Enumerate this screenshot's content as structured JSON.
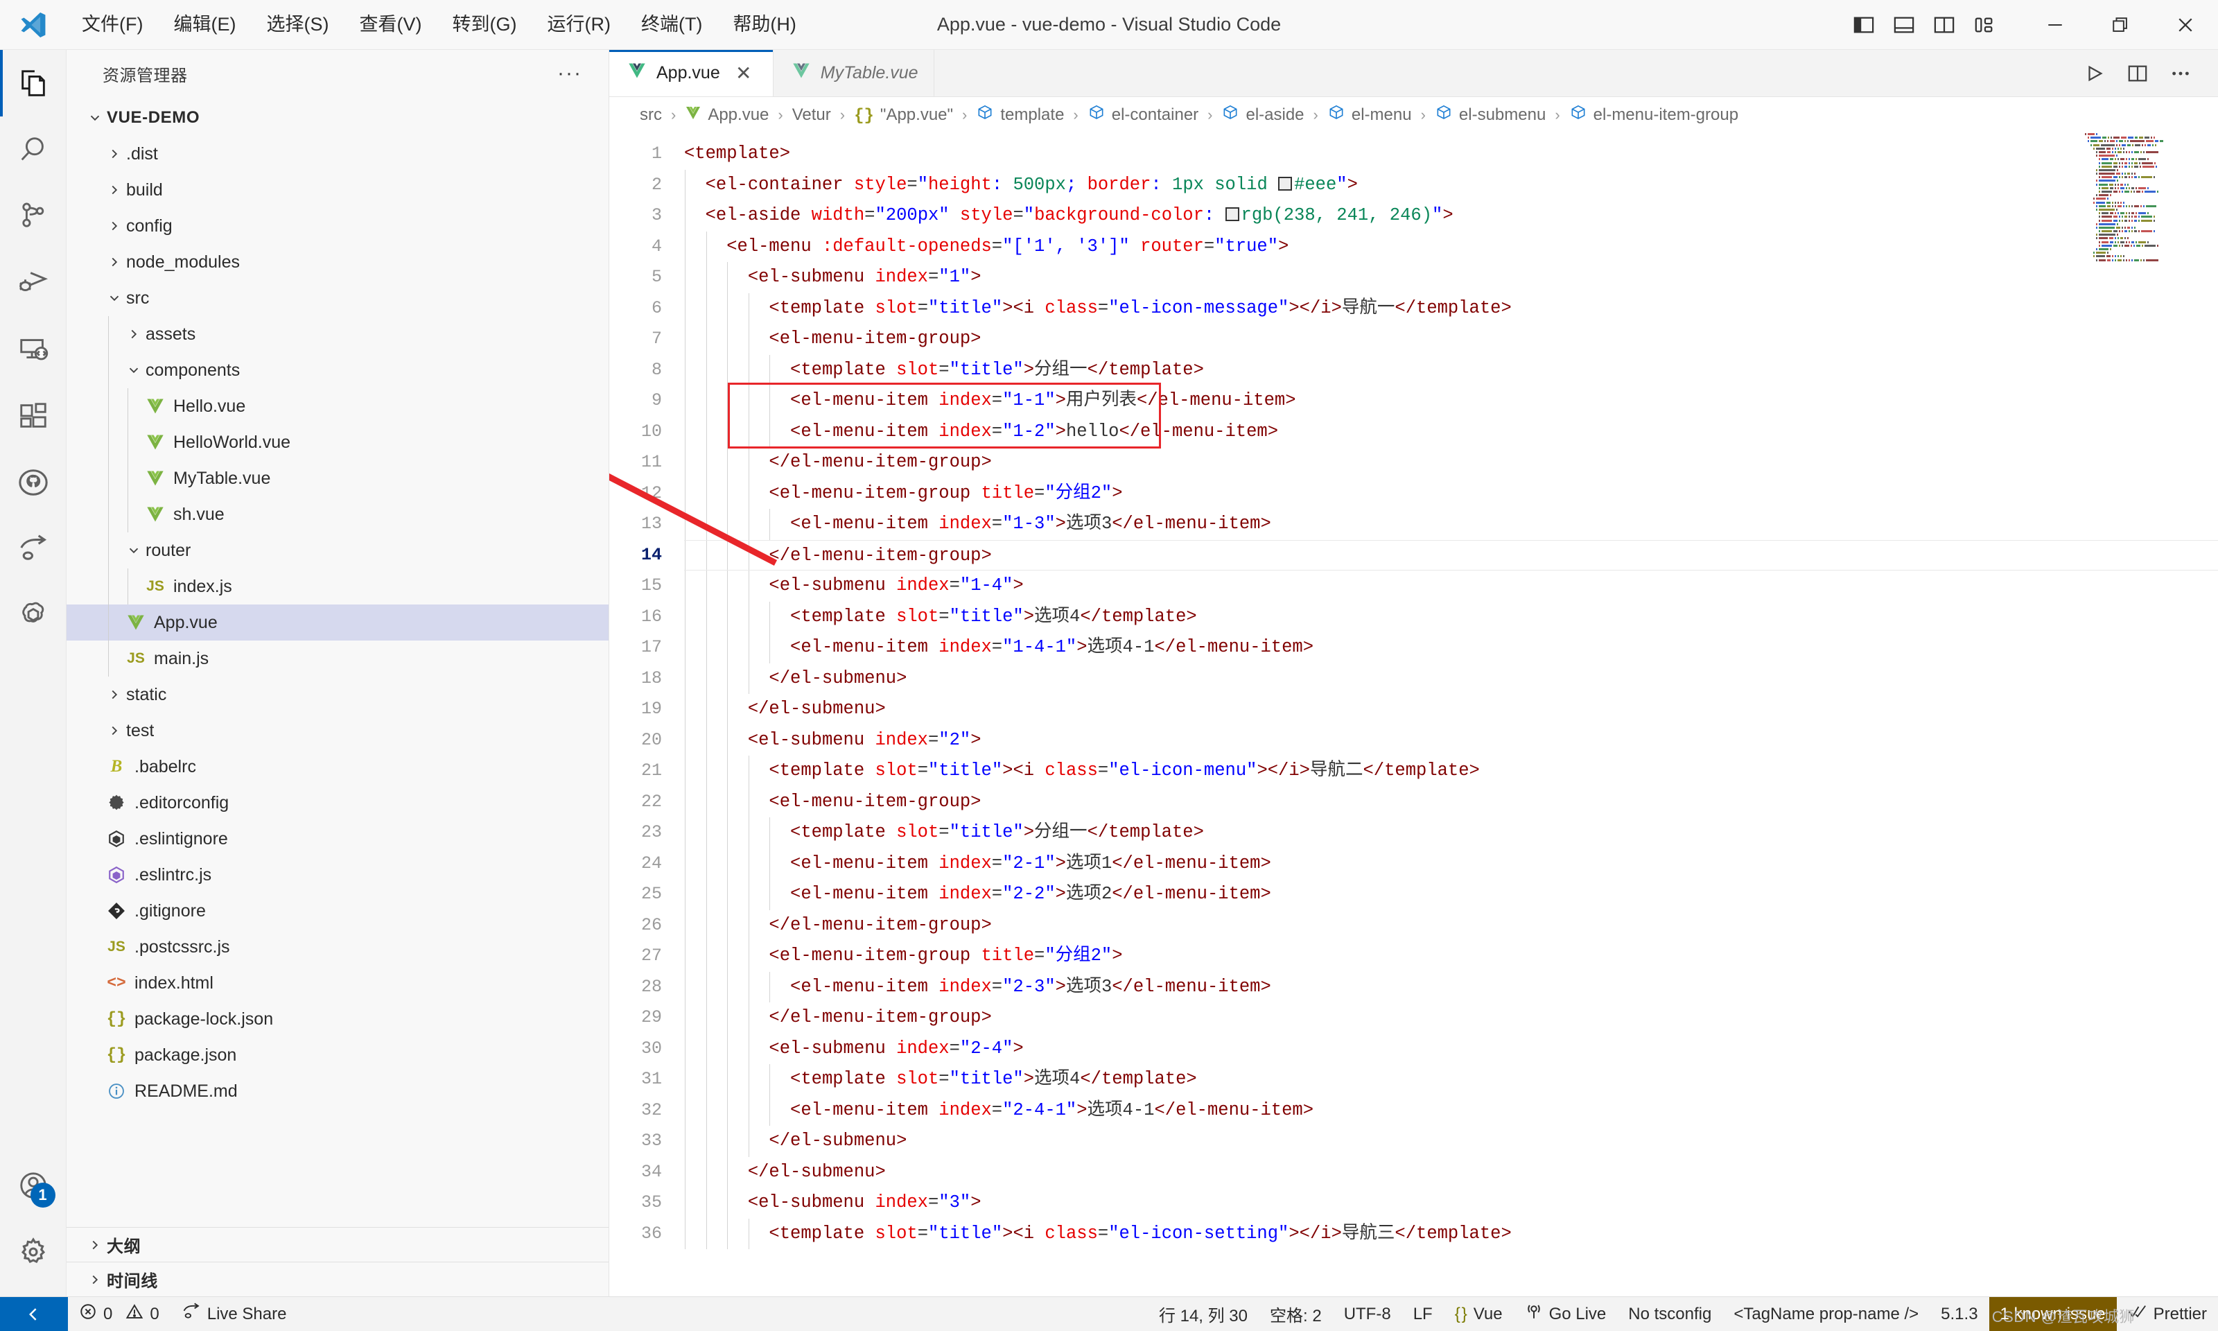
{
  "window": {
    "title": "App.vue - vue-demo - Visual Studio Code",
    "menus": [
      {
        "label": "文件(F)",
        "name": "menu-file"
      },
      {
        "label": "编辑(E)",
        "name": "menu-edit"
      },
      {
        "label": "选择(S)",
        "name": "menu-selection"
      },
      {
        "label": "查看(V)",
        "name": "menu-view"
      },
      {
        "label": "转到(G)",
        "name": "menu-goto"
      },
      {
        "label": "运行(R)",
        "name": "menu-run"
      },
      {
        "label": "终端(T)",
        "name": "menu-terminal"
      },
      {
        "label": "帮助(H)",
        "name": "menu-help"
      }
    ],
    "layout_buttons": [
      "toggle-primary-sidebar",
      "toggle-panel",
      "toggle-secondary-sidebar",
      "customize-layout"
    ],
    "controls": {
      "minimize": "—",
      "maximize": "❐",
      "close": "✕"
    }
  },
  "activitybar": {
    "items": [
      {
        "name": "explorer",
        "icon": "files-icon",
        "active": true
      },
      {
        "name": "search",
        "icon": "search-icon",
        "active": false
      },
      {
        "name": "source-control",
        "icon": "source-control-icon",
        "active": false
      },
      {
        "name": "run-and-debug",
        "icon": "debug-icon",
        "active": false
      },
      {
        "name": "remote-explorer",
        "icon": "remote-icon",
        "active": false
      },
      {
        "name": "extensions",
        "icon": "extensions-icon",
        "active": false
      },
      {
        "name": "github",
        "icon": "github-icon",
        "active": false
      },
      {
        "name": "live-share",
        "icon": "live-share-icon",
        "active": false
      },
      {
        "name": "openai",
        "icon": "openai-icon",
        "active": false
      }
    ],
    "bottom": [
      {
        "name": "accounts",
        "icon": "account-icon",
        "badge": "1"
      },
      {
        "name": "settings",
        "icon": "gear-icon",
        "badge": ""
      }
    ]
  },
  "sidebar": {
    "header": "资源管理器",
    "more_actions": "···",
    "root": {
      "label": "VUE-DEMO",
      "expanded": true
    },
    "tree": [
      {
        "label": ".dist",
        "depth": 1,
        "type": "folder",
        "expanded": false
      },
      {
        "label": "build",
        "depth": 1,
        "type": "folder",
        "expanded": false
      },
      {
        "label": "config",
        "depth": 1,
        "type": "folder",
        "expanded": false
      },
      {
        "label": "node_modules",
        "depth": 1,
        "type": "folder",
        "expanded": false
      },
      {
        "label": "src",
        "depth": 1,
        "type": "folder",
        "expanded": true
      },
      {
        "label": "assets",
        "depth": 2,
        "type": "folder",
        "expanded": false
      },
      {
        "label": "components",
        "depth": 2,
        "type": "folder",
        "expanded": true
      },
      {
        "label": "Hello.vue",
        "depth": 3,
        "type": "vue"
      },
      {
        "label": "HelloWorld.vue",
        "depth": 3,
        "type": "vue"
      },
      {
        "label": "MyTable.vue",
        "depth": 3,
        "type": "vue"
      },
      {
        "label": "sh.vue",
        "depth": 3,
        "type": "vue"
      },
      {
        "label": "router",
        "depth": 2,
        "type": "folder",
        "expanded": true
      },
      {
        "label": "index.js",
        "depth": 3,
        "type": "js"
      },
      {
        "label": "App.vue",
        "depth": 2,
        "type": "vue",
        "selected": true
      },
      {
        "label": "main.js",
        "depth": 2,
        "type": "js"
      },
      {
        "label": "static",
        "depth": 1,
        "type": "folder",
        "expanded": false
      },
      {
        "label": "test",
        "depth": 1,
        "type": "folder",
        "expanded": false
      },
      {
        "label": ".babelrc",
        "depth": 1,
        "type": "babel"
      },
      {
        "label": ".editorconfig",
        "depth": 1,
        "type": "editorconfig"
      },
      {
        "label": ".eslintignore",
        "depth": 1,
        "type": "eslintignore"
      },
      {
        "label": ".eslintrc.js",
        "depth": 1,
        "type": "eslint"
      },
      {
        "label": ".gitignore",
        "depth": 1,
        "type": "git"
      },
      {
        "label": ".postcssrc.js",
        "depth": 1,
        "type": "js"
      },
      {
        "label": "index.html",
        "depth": 1,
        "type": "html"
      },
      {
        "label": "package-lock.json",
        "depth": 1,
        "type": "json"
      },
      {
        "label": "package.json",
        "depth": 1,
        "type": "json"
      },
      {
        "label": "README.md",
        "depth": 1,
        "type": "md"
      }
    ],
    "sections": [
      {
        "label": "大纲",
        "name": "outline"
      },
      {
        "label": "时间线",
        "name": "timeline"
      }
    ]
  },
  "editor": {
    "tabs": [
      {
        "label": "App.vue",
        "active": true,
        "preview": false,
        "close": "✕",
        "icon": "vue-icon"
      },
      {
        "label": "MyTable.vue",
        "active": false,
        "preview": true,
        "close": "",
        "icon": "vue-icon"
      }
    ],
    "actions": [
      "run-icon",
      "split-editor-icon",
      "more-actions-icon"
    ],
    "breadcrumb": [
      {
        "label": "src",
        "icon": ""
      },
      {
        "label": "App.vue",
        "icon": "vue-icon"
      },
      {
        "label": "Vetur",
        "icon": ""
      },
      {
        "label": "\"App.vue\"",
        "icon": "json-icon"
      },
      {
        "label": "template",
        "icon": "symbol-icon"
      },
      {
        "label": "el-container",
        "icon": "symbol-icon"
      },
      {
        "label": "el-aside",
        "icon": "symbol-icon"
      },
      {
        "label": "el-menu",
        "icon": "symbol-icon"
      },
      {
        "label": "el-submenu",
        "icon": "symbol-icon"
      },
      {
        "label": "el-menu-item-group",
        "icon": "symbol-icon"
      }
    ],
    "cursor_line": 14,
    "first_line": 1,
    "lines": [
      {
        "n": 1,
        "indent": 0,
        "guides": 0,
        "text": "<template>"
      },
      {
        "n": 2,
        "indent": 1,
        "guides": 1,
        "text": "  <el-container style=\"height: 500px; border: 1px solid ▣#eee\">"
      },
      {
        "n": 3,
        "indent": 1,
        "guides": 1,
        "text": "  <el-aside width=\"200px\" style=\"background-color: ▣rgb(238, 241, 246)\">"
      },
      {
        "n": 4,
        "indent": 2,
        "guides": 2,
        "text": "    <el-menu :default-openeds=\"['1', '3']\" router=\"true\">"
      },
      {
        "n": 5,
        "indent": 3,
        "guides": 3,
        "text": "      <el-submenu index=\"1\">"
      },
      {
        "n": 6,
        "indent": 4,
        "guides": 4,
        "text": "        <template slot=\"title\"><i class=\"el-icon-message\"></i>导航一</template>"
      },
      {
        "n": 7,
        "indent": 4,
        "guides": 4,
        "text": "        <el-menu-item-group>"
      },
      {
        "n": 8,
        "indent": 5,
        "guides": 5,
        "text": "          <template slot=\"title\">分组一</template>"
      },
      {
        "n": 9,
        "indent": 5,
        "guides": 5,
        "text": "          <el-menu-item index=\"1-1\">用户列表</el-menu-item>"
      },
      {
        "n": 10,
        "indent": 5,
        "guides": 5,
        "text": "          <el-menu-item index=\"1-2\">hello</el-menu-item>"
      },
      {
        "n": 11,
        "indent": 4,
        "guides": 4,
        "text": "        </el-menu-item-group>"
      },
      {
        "n": 12,
        "indent": 4,
        "guides": 4,
        "text": "        <el-menu-item-group title=\"分组2\">"
      },
      {
        "n": 13,
        "indent": 5,
        "guides": 5,
        "text": "          <el-menu-item index=\"1-3\">选项3</el-menu-item>"
      },
      {
        "n": 14,
        "indent": 4,
        "guides": 4,
        "text": "        </el-menu-item-group>"
      },
      {
        "n": 15,
        "indent": 4,
        "guides": 4,
        "text": "        <el-submenu index=\"1-4\">"
      },
      {
        "n": 16,
        "indent": 5,
        "guides": 5,
        "text": "          <template slot=\"title\">选项4</template>"
      },
      {
        "n": 17,
        "indent": 5,
        "guides": 5,
        "text": "          <el-menu-item index=\"1-4-1\">选项4-1</el-menu-item>"
      },
      {
        "n": 18,
        "indent": 4,
        "guides": 4,
        "text": "        </el-submenu>"
      },
      {
        "n": 19,
        "indent": 3,
        "guides": 3,
        "text": "      </el-submenu>"
      },
      {
        "n": 20,
        "indent": 3,
        "guides": 3,
        "text": "      <el-submenu index=\"2\">"
      },
      {
        "n": 21,
        "indent": 4,
        "guides": 4,
        "text": "        <template slot=\"title\"><i class=\"el-icon-menu\"></i>导航二</template>"
      },
      {
        "n": 22,
        "indent": 4,
        "guides": 4,
        "text": "        <el-menu-item-group>"
      },
      {
        "n": 23,
        "indent": 5,
        "guides": 5,
        "text": "          <template slot=\"title\">分组一</template>"
      },
      {
        "n": 24,
        "indent": 5,
        "guides": 5,
        "text": "          <el-menu-item index=\"2-1\">选项1</el-menu-item>"
      },
      {
        "n": 25,
        "indent": 5,
        "guides": 5,
        "text": "          <el-menu-item index=\"2-2\">选项2</el-menu-item>"
      },
      {
        "n": 26,
        "indent": 4,
        "guides": 4,
        "text": "        </el-menu-item-group>"
      },
      {
        "n": 27,
        "indent": 4,
        "guides": 4,
        "text": "        <el-menu-item-group title=\"分组2\">"
      },
      {
        "n": 28,
        "indent": 5,
        "guides": 5,
        "text": "          <el-menu-item index=\"2-3\">选项3</el-menu-item>"
      },
      {
        "n": 29,
        "indent": 4,
        "guides": 4,
        "text": "        </el-menu-item-group>"
      },
      {
        "n": 30,
        "indent": 4,
        "guides": 4,
        "text": "        <el-submenu index=\"2-4\">"
      },
      {
        "n": 31,
        "indent": 5,
        "guides": 5,
        "text": "          <template slot=\"title\">选项4</template>"
      },
      {
        "n": 32,
        "indent": 5,
        "guides": 5,
        "text": "          <el-menu-item index=\"2-4-1\">选项4-1</el-menu-item>"
      },
      {
        "n": 33,
        "indent": 4,
        "guides": 4,
        "text": "        </el-submenu>"
      },
      {
        "n": 34,
        "indent": 3,
        "guides": 3,
        "text": "      </el-submenu>"
      },
      {
        "n": 35,
        "indent": 3,
        "guides": 3,
        "text": "      <el-submenu index=\"3\">"
      },
      {
        "n": 36,
        "indent": 4,
        "guides": 4,
        "text": "        <template slot=\"title\"><i class=\"el-icon-setting\"></i>导航三</template>"
      }
    ],
    "annotation": {
      "type": "red-box-with-arrow",
      "color": "#e8262a",
      "highlights_lines": [
        9,
        10
      ]
    }
  },
  "statusbar": {
    "remote_icon": "remote-indicator-icon",
    "left": [
      {
        "name": "problems",
        "icon": "error-warning-icon",
        "label": "0   0",
        "errors": "0",
        "warnings": "0"
      },
      {
        "name": "live-share",
        "icon": "live-share-icon",
        "label": "Live Share"
      }
    ],
    "right": [
      {
        "name": "editor-position",
        "label": "行 14, 列 30"
      },
      {
        "name": "editor-indentation",
        "label": "空格: 2"
      },
      {
        "name": "editor-encoding",
        "label": "UTF-8"
      },
      {
        "name": "editor-eol",
        "label": "LF"
      },
      {
        "name": "editor-language",
        "label": "Vue",
        "icon": "json-icon"
      },
      {
        "name": "go-live",
        "label": "Go Live",
        "icon": "broadcast-icon"
      },
      {
        "name": "tsconfig",
        "label": "No tsconfig"
      },
      {
        "name": "tagname-prop",
        "label": "<TagName prop-name />"
      },
      {
        "name": "version",
        "label": "5.1.3"
      },
      {
        "name": "known-issues",
        "label": "1 known issue",
        "warn": true
      },
      {
        "name": "prettier",
        "label": "Prettier",
        "icon": "check-check-icon"
      }
    ],
    "watermark": "CSDN @渣瓦攻城狮"
  }
}
